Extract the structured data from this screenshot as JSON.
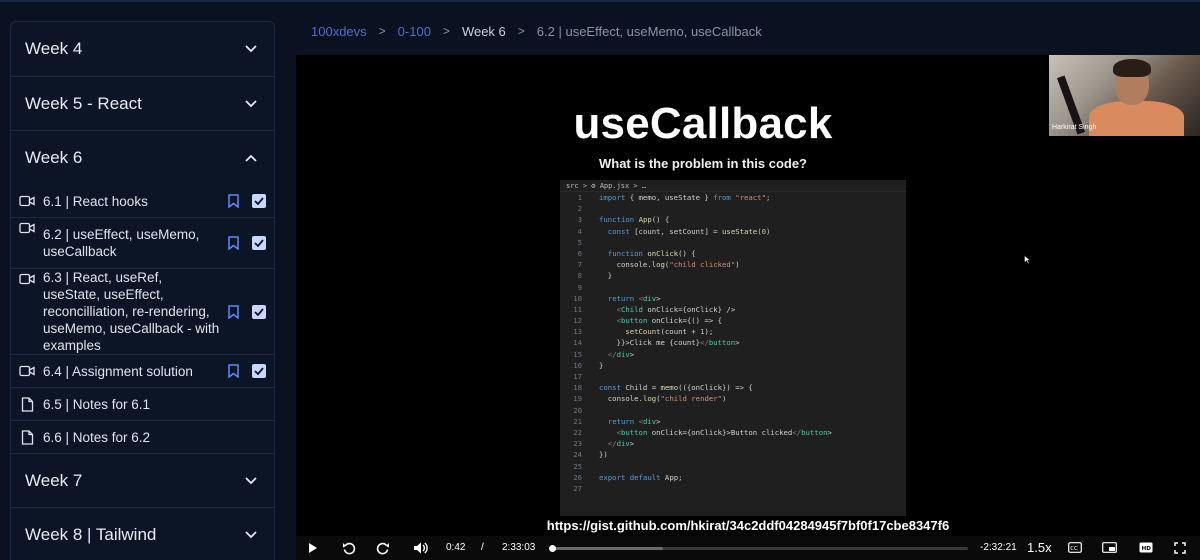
{
  "sidebar": {
    "weeks_top": [
      {
        "label": "Week 4",
        "expanded": false
      },
      {
        "label": "Week 5 - React",
        "expanded": false
      },
      {
        "label": "Week 6",
        "expanded": true
      }
    ],
    "lessons": [
      {
        "label": "6.1 | React hooks",
        "type": "video",
        "bookmark": true,
        "checked": true
      },
      {
        "label": "6.2 | useEffect, useMemo, useCallback",
        "type": "video",
        "bookmark": true,
        "checked": true
      },
      {
        "label": "6.3 | React, useRef, useState, useEffect, reconcilliation, re-rendering, useMemo, useCallback - with examples",
        "type": "video",
        "bookmark": true,
        "checked": true
      },
      {
        "label": "6.4 | Assignment solution",
        "type": "video",
        "bookmark": true,
        "checked": true
      },
      {
        "label": "6.5 | Notes for 6.1",
        "type": "notes",
        "bookmark": false,
        "checked": false
      },
      {
        "label": "6.6 | Notes for 6.2",
        "type": "notes",
        "bookmark": false,
        "checked": false
      }
    ],
    "weeks_bottom": [
      {
        "label": "Week 7",
        "expanded": false
      },
      {
        "label": "Week 8 | Tailwind",
        "expanded": false
      }
    ]
  },
  "breadcrumb": [
    "100xdevs",
    "0-100",
    "Week 6",
    "6.2 | useEffect, useMemo, useCallback"
  ],
  "video": {
    "slide_title": "useCallback",
    "slide_subtitle": "What is the problem in this code?",
    "presenter_name": "Harkirat Singh",
    "editor_tab": "src  >  ⚙ App.jsx  >  …",
    "url_caption": "https://gist.github.com/hkirat/34c2ddf04284945f7bf0f17cbe8347f6",
    "code_lines": [
      "import { memo, useState } from \"react\";",
      "",
      "function App() {",
      "  const [count, setCount] = useState(0)",
      "",
      "  function onClick() {",
      "    console.log(\"child clicked\")",
      "  }",
      "",
      "  return <div>",
      "    <Child onClick={onClick} />",
      "    <button onClick={() => {",
      "      setCount(count + 1);",
      "    }}>Click me {count}</button>",
      "  </div>",
      "}",
      "",
      "const Child = memo(({onClick}) => {",
      "  console.log(\"child render\")",
      "",
      "  return <div>",
      "    <button onClick={onClick}>Button clicked</button>",
      "  </div>",
      "})",
      "",
      "export default App;",
      ""
    ]
  },
  "controls": {
    "current_time": "0:42",
    "time_separator": "/",
    "duration": "2:33:03",
    "remaining": "-2:32:21",
    "speed": "1.5x",
    "progress": 0.0046,
    "buffered": 0.27,
    "colors": {
      "accent": "#4e6fd0"
    }
  }
}
